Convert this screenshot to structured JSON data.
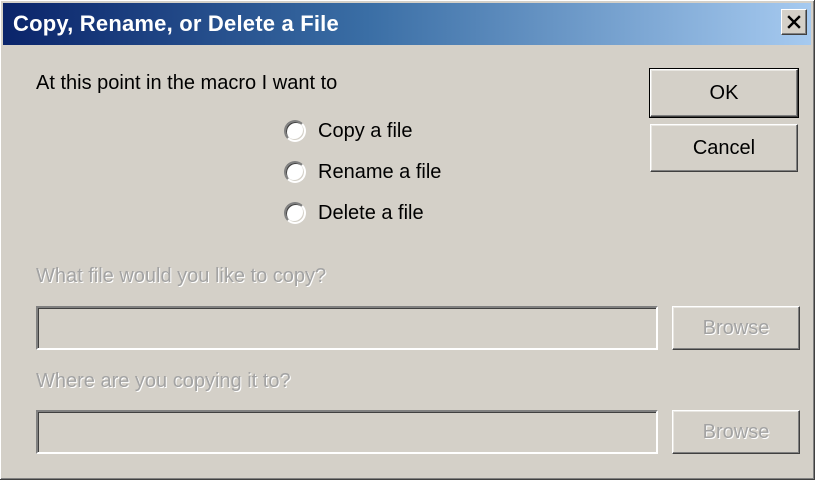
{
  "window": {
    "title": "Copy, Rename, or Delete a File",
    "close_icon": "close-x-icon"
  },
  "prompt": "At this point in the macro I want to",
  "options": [
    {
      "label": "Copy a file",
      "selected": false
    },
    {
      "label": "Rename a file",
      "selected": false
    },
    {
      "label": "Delete a file",
      "selected": false
    }
  ],
  "buttons": {
    "ok": "OK",
    "cancel": "Cancel",
    "browse_source": "Browse",
    "browse_destination": "Browse"
  },
  "source": {
    "label": "What file would you like to copy?",
    "value": "",
    "enabled": false
  },
  "destination": {
    "label": "Where are you copying it to?",
    "value": "",
    "enabled": false
  },
  "colors": {
    "title_gradient_start": "#0a246a",
    "title_gradient_end": "#a6caf0",
    "face": "#d4d0c8",
    "disabled_text": "#a3a3a3"
  }
}
